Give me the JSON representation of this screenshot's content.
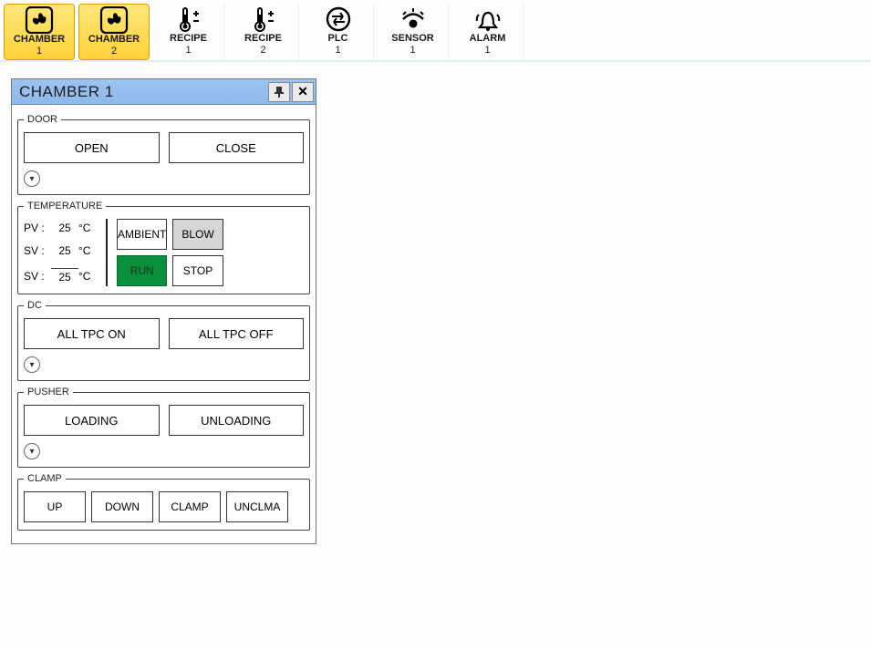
{
  "toolbar": {
    "tabs": [
      {
        "label": "CHAMBER",
        "sub": "1",
        "icon": "fan",
        "active": true
      },
      {
        "label": "CHAMBER",
        "sub": "2",
        "icon": "fan",
        "active": true
      },
      {
        "label": "RECIPE",
        "sub": "1",
        "icon": "thermo"
      },
      {
        "label": "RECIPE",
        "sub": "2",
        "icon": "thermo"
      },
      {
        "label": "PLC",
        "sub": "1",
        "icon": "swap"
      },
      {
        "label": "SENSOR",
        "sub": "1",
        "icon": "sensor"
      },
      {
        "label": "ALARM",
        "sub": "1",
        "icon": "alarm"
      }
    ]
  },
  "panel": {
    "title": "CHAMBER 1",
    "pin_label": "Pin",
    "close_label": "Close",
    "groups": {
      "door": {
        "legend": "DOOR",
        "open": "OPEN",
        "close": "CLOSE"
      },
      "temperature": {
        "legend": "TEMPERATURE",
        "pv_label": "PV :",
        "pv_value": "25",
        "pv_unit": "°C",
        "sv1_label": "SV :",
        "sv1_value": "25",
        "sv1_unit": "°C",
        "sv2_label": "SV :",
        "sv2_value": "25",
        "sv2_unit": "°C",
        "ambient": "AMBIENT",
        "blow": "BLOW",
        "run": "RUN",
        "stop": "STOP"
      },
      "dc": {
        "legend": "DC",
        "on": "ALL TPC ON",
        "off": "ALL TPC OFF"
      },
      "pusher": {
        "legend": "PUSHER",
        "loading": "LOADING",
        "unloading": "UNLOADING"
      },
      "clamp": {
        "legend": "CLAMP",
        "up": "UP",
        "down": "DOWN",
        "clamp": "CLAMP",
        "unclamp": "UNCLMA"
      }
    }
  }
}
